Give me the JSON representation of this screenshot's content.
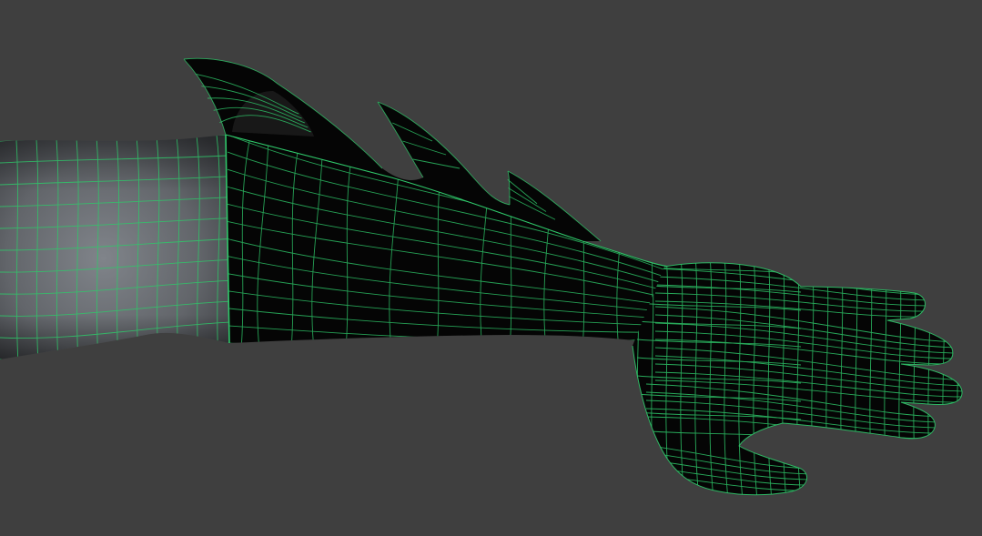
{
  "viewport": {
    "background_color": "#3f3f3f",
    "shading": "wireframe-on-shaded",
    "wire_color": "#2fc86a",
    "skin_color": "#6e7176",
    "gauntlet_color": "#050505"
  },
  "model": {
    "subject": "arm",
    "parts": [
      "upper-arm",
      "gauntlet",
      "fin-spikes",
      "hand"
    ]
  }
}
